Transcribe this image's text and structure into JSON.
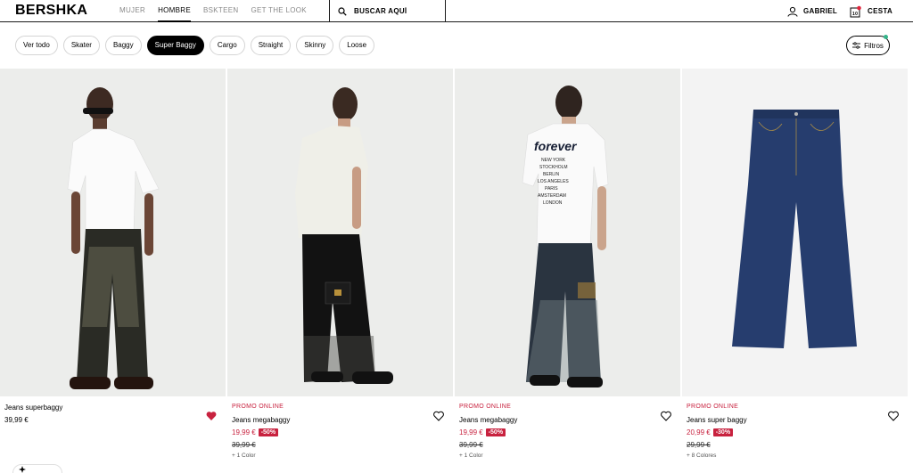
{
  "header": {
    "logo": "BERSHKA",
    "nav": [
      "MUJER",
      "HOMBRE",
      "BSKTEEN",
      "GET THE LOOK"
    ],
    "active_nav": "HOMBRE",
    "search_placeholder": "BUSCAR AQUÍ",
    "user_label": "GABRIEL",
    "cart_label": "CESTA"
  },
  "filters": {
    "chips": [
      "Ver todo",
      "Skater",
      "Baggy",
      "Super Baggy",
      "Cargo",
      "Straight",
      "Skinny",
      "Loose"
    ],
    "active": "Super Baggy",
    "filter_button": "Filtros"
  },
  "products": [
    {
      "promo": "",
      "name": "Jeans superbaggy",
      "price": "39,99 €",
      "discount": "",
      "old_price": "",
      "colors": "",
      "favorited": true
    },
    {
      "promo": "PROMO ONLINE",
      "name": "Jeans megabaggy",
      "price": "19,99 €",
      "discount": "-50%",
      "old_price": "39,99 €",
      "colors": "+ 1 Color",
      "favorited": false
    },
    {
      "promo": "PROMO ONLINE",
      "name": "Jeans megabaggy",
      "price": "19,99 €",
      "discount": "-50%",
      "old_price": "39,99 €",
      "colors": "+ 1 Color",
      "favorited": false
    },
    {
      "promo": "PROMO ONLINE",
      "name": "Jeans super baggy",
      "price": "20,99 €",
      "discount": "-30%",
      "old_price": "29,99 €",
      "colors": "+ 8 Colores",
      "favorited": false
    }
  ],
  "tshirt_print": [
    "forever",
    "NEW YORK",
    "STOCKHOLM",
    "BERLIN",
    "LOS ANGELES",
    "PARIS",
    "AMSTERDAM",
    "LONDON"
  ],
  "colors": {
    "sale": "#c8223f",
    "cart_badge": "#e0243c",
    "filter_dot": "#35b58a"
  }
}
